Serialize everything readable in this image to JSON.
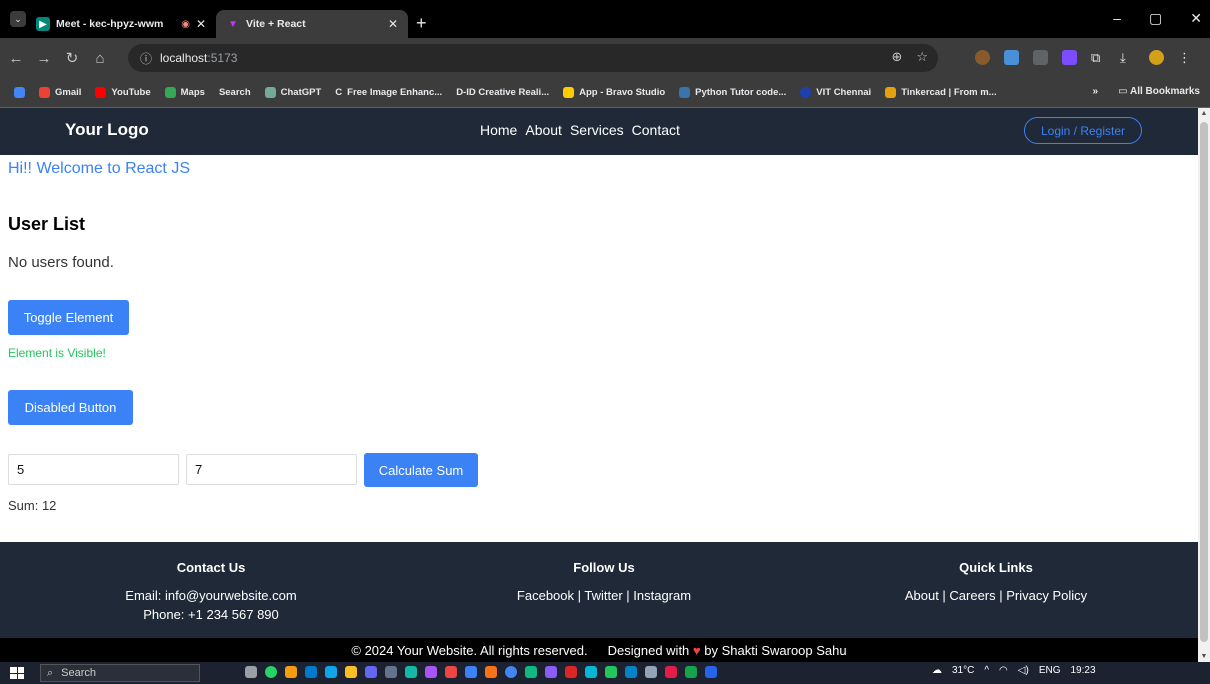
{
  "browser": {
    "tabs": [
      {
        "title": "Meet - kec-hpyz-wwm",
        "favicon": "meet-icon",
        "active": false
      },
      {
        "title": "Vite + React",
        "favicon": "vite-icon",
        "active": true
      }
    ],
    "address": {
      "host": "localhost",
      "port": ":5173"
    },
    "bookmarks": [
      {
        "label": "Gmail",
        "color": "#ea4335"
      },
      {
        "label": "YouTube",
        "color": "#ff0000"
      },
      {
        "label": "Maps",
        "color": "#34a853"
      },
      {
        "label": "Search",
        "color": "#4285f4"
      },
      {
        "label": "ChatGPT",
        "color": "#74aa9c"
      },
      {
        "label": "Free Image Enhanc...",
        "color": "#ffffff"
      },
      {
        "label": "D-ID Creative Reali...",
        "color": "#333333"
      },
      {
        "label": "App - Bravo Studio",
        "color": "#ffcc00"
      },
      {
        "label": "Python Tutor code...",
        "color": "#3776ab"
      },
      {
        "label": "VIT Chennai",
        "color": "#1e40af"
      },
      {
        "label": "Tinkercad | From m...",
        "color": "#e5a00d"
      }
    ],
    "all_bookmarks": "All Bookmarks",
    "more_bookmarks": "»"
  },
  "site": {
    "logo": "Your Logo",
    "nav": [
      "Home",
      "About",
      "Services",
      "Contact"
    ],
    "login": "Login / Register",
    "welcome": "Hi!! Welcome to React JS",
    "user_list_title": "User List",
    "no_users": "No users found.",
    "toggle_label": "Toggle Element",
    "visible_msg": "Element is Visible!",
    "disabled_label": "Disabled Button",
    "input_a": "5",
    "input_b": "7",
    "sum_label": "Calculate Sum",
    "sum_text": "Sum: 12",
    "footer": {
      "contact": {
        "title": "Contact Us",
        "email": "Email: info@yourwebsite.com",
        "phone": "Phone: +1 234 567 890"
      },
      "follow": {
        "title": "Follow Us",
        "links": "Facebook | Twitter | Instagram"
      },
      "quick": {
        "title": "Quick Links",
        "links": "About | Careers | Privacy Policy"
      }
    },
    "copyright": "© 2024 Your Website. All rights reserved.",
    "designed_prefix": "Designed with",
    "designed_suffix": "by Shakti Swaroop Sahu"
  },
  "taskbar": {
    "search_placeholder": "Search",
    "weather": "31°C",
    "lang": "ENG",
    "time": "19:23"
  },
  "colors": {
    "accent": "#3b82f6",
    "nav_bg": "#1f2937",
    "success": "#22c55e"
  }
}
